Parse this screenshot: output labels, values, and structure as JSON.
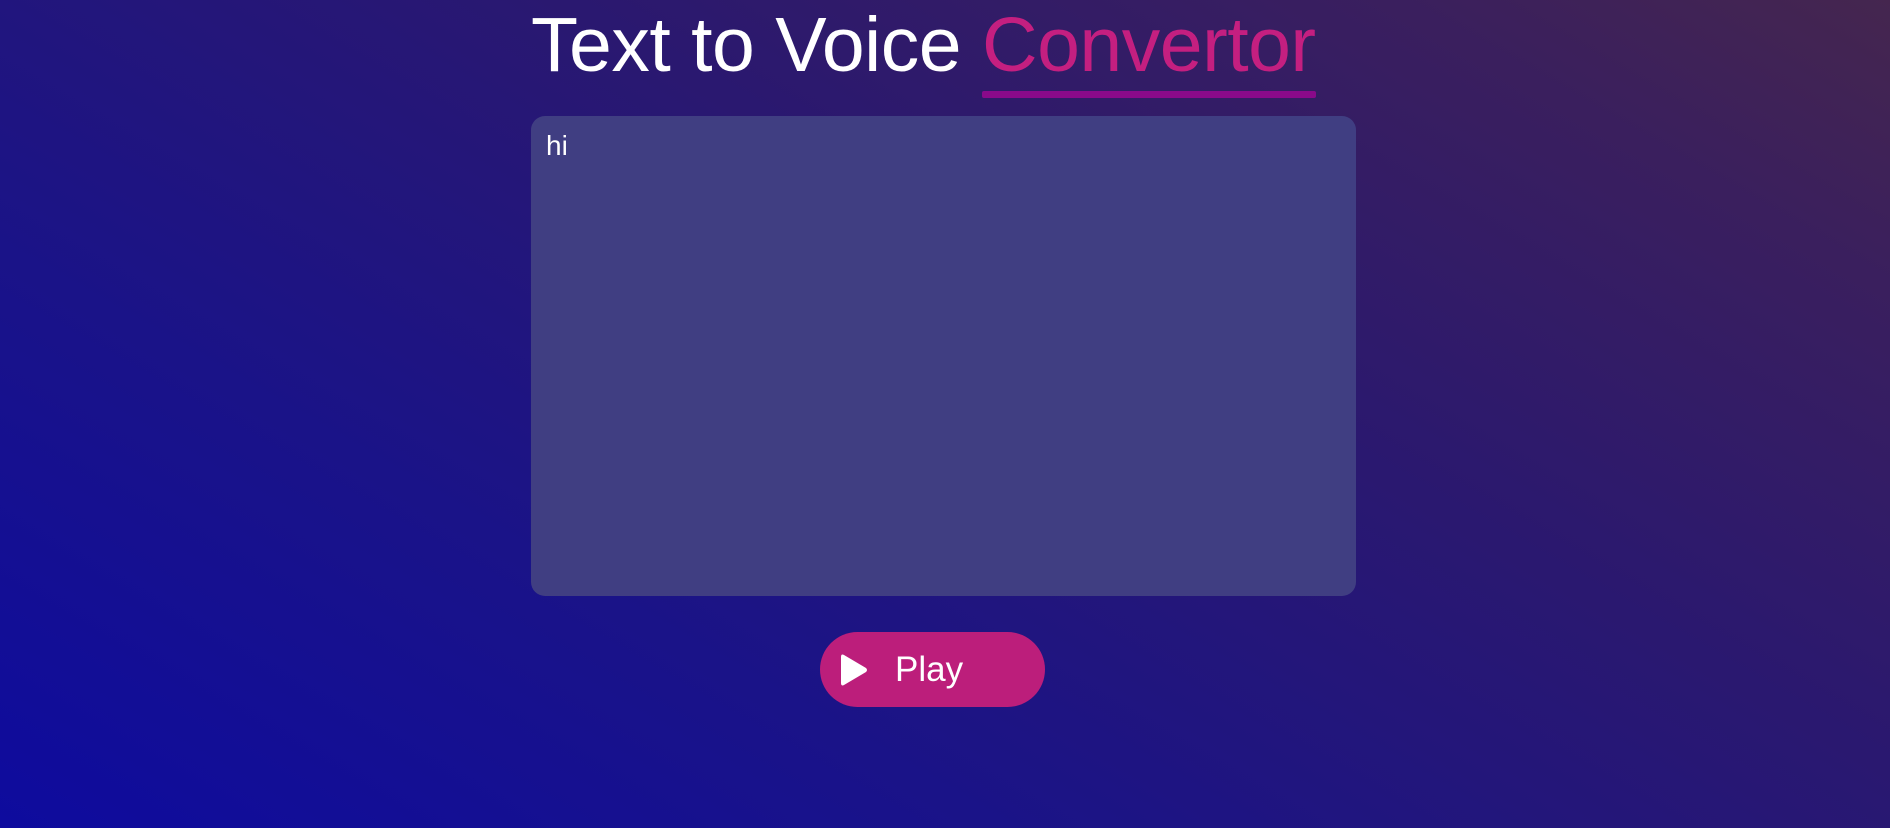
{
  "title": {
    "main": "Text to Voice ",
    "accent": "Convertor"
  },
  "text_input": {
    "value": "hi",
    "placeholder": ""
  },
  "play_button": {
    "label": "Play",
    "icon": "play-icon"
  },
  "colors": {
    "accent": "#c41f80",
    "underline": "#8a0a8a",
    "button": "#bc1e7b",
    "textarea_bg": "#403e82"
  }
}
